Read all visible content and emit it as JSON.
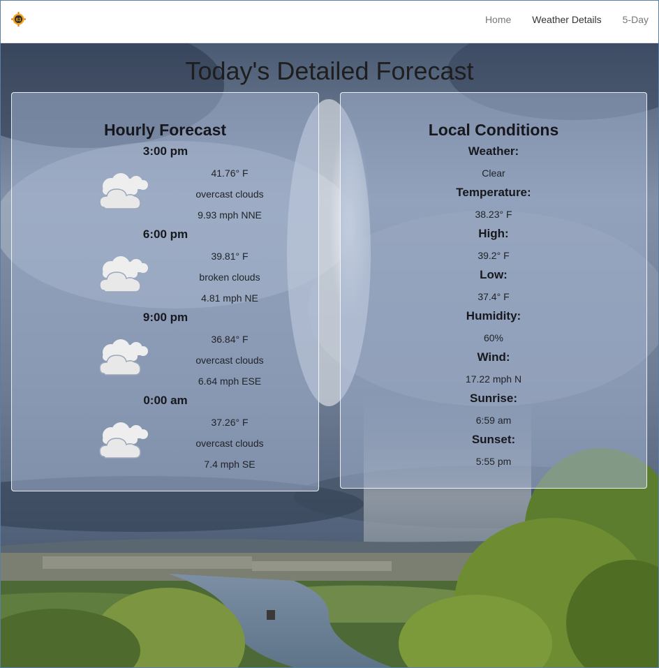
{
  "nav": {
    "logo_icon": "weather-sun-logo-icon",
    "links": [
      {
        "label": "Home"
      },
      {
        "label": "Weather Details"
      },
      {
        "label": "5-Day"
      }
    ]
  },
  "page": {
    "title": "Today's Detailed Forecast"
  },
  "hourly": {
    "heading": "Hourly Forecast",
    "icon": "cloudy-icon",
    "items": [
      {
        "time": "3:00 pm",
        "temp": "41.76° F",
        "desc": "overcast clouds",
        "wind": "9.93 mph NNE"
      },
      {
        "time": "6:00 pm",
        "temp": "39.81° F",
        "desc": "broken clouds",
        "wind": "4.81 mph NE"
      },
      {
        "time": "9:00 pm",
        "temp": "36.84° F",
        "desc": "overcast clouds",
        "wind": "6.64 mph ESE"
      },
      {
        "time": "0:00 am",
        "temp": "37.26° F",
        "desc": "overcast clouds",
        "wind": "7.4 mph SE"
      }
    ]
  },
  "local": {
    "heading": "Local Conditions",
    "items": [
      {
        "label": "Weather:",
        "value": "Clear"
      },
      {
        "label": "Temperature:",
        "value": "38.23° F"
      },
      {
        "label": "High:",
        "value": "39.2° F"
      },
      {
        "label": "Low:",
        "value": "37.4° F"
      },
      {
        "label": "Humidity:",
        "value": "60%"
      },
      {
        "label": "Wind:",
        "value": "17.22 mph N"
      },
      {
        "label": "Sunrise:",
        "value": "6:59 am"
      },
      {
        "label": "Sunset:",
        "value": "5:55 pm"
      }
    ]
  },
  "colors": {
    "panel_bg": "#a0b0cd",
    "text_dark": "#16181d",
    "nav_text": "#777777",
    "nav_active": "#333333"
  }
}
